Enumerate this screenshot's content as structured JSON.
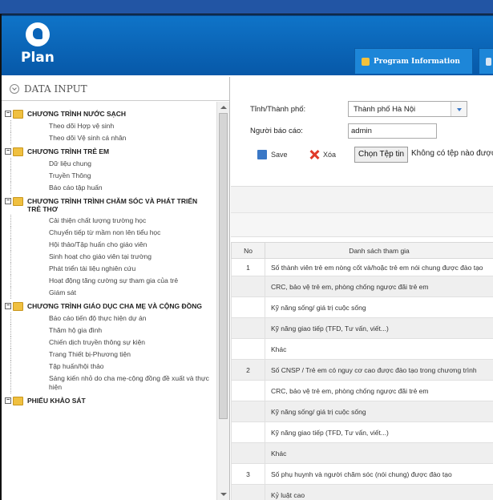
{
  "header": {
    "logo_text": "Plan",
    "tabs": [
      {
        "label": "Program Information",
        "icon": "document-icon"
      },
      {
        "label": "",
        "icon": "monitor-icon"
      }
    ]
  },
  "sidebar": {
    "title": "DATA INPUT",
    "groups": [
      {
        "label": "CHƯƠNG TRÌNH NƯỚC SẠCH",
        "items": [
          "Theo dõi Hợp vệ sinh",
          "Theo dõi Vệ sinh cá nhân"
        ]
      },
      {
        "label": "CHƯƠNG TRÌNH TRẺ EM",
        "items": [
          "Dữ liệu chung",
          "Truyền Thông",
          "Báo cáo tập huấn"
        ]
      },
      {
        "label": "CHƯƠNG TRÌNH TRÌNH CHĂM SÓC VÀ PHÁT TRIỂN TRẺ THƠ",
        "items": [
          "Cải thiện chất lượng trường học",
          "Chuyển tiếp từ mầm non lên tiểu học",
          "Hội thảo/Tập huấn cho giáo viên",
          "Sinh hoạt cho giáo viên tại trường",
          "Phát triển tài liệu nghiên cứu",
          "Hoạt động tăng cường sự tham gia của trẻ",
          "Giám sát"
        ]
      },
      {
        "label": "CHƯƠNG TRÌNH GIÁO DỤC CHA MẸ VÀ CỘNG ĐỒNG",
        "items": [
          "Báo cáo tiến độ thực hiện dự án",
          "Thăm hộ gia đình",
          "Chiến dịch truyền thông sự kiện",
          "Trang Thiết bị-Phương tiện",
          "Tập huấn/hội thảo",
          "Sáng kiến nhỏ do cha mẹ-cộng đồng đề xuất và thực hiện"
        ]
      },
      {
        "label": "PHIẾU KHẢO SÁT",
        "items": []
      }
    ]
  },
  "form": {
    "province_label": "Tỉnh/Thành phố:",
    "province_value": "Thành phố Hà Nội",
    "reporter_label": "Người báo cáo:",
    "reporter_value": "admin",
    "save_label": "Save",
    "delete_label": "Xóa",
    "choose_file_label": "Chọn Tệp tin",
    "no_file_text": "Không có tệp nào được chọn"
  },
  "table": {
    "headers": {
      "no": "No",
      "list": "Danh sách tham gia"
    },
    "rows": [
      {
        "no": "1",
        "text": "Số thành viên trẻ em nòng cốt và/hoặc trẻ em nói chung được đào tạo",
        "alt": false
      },
      {
        "no": "",
        "text": "CRC, bảo vệ trẻ em, phòng chống ngược đãi trẻ em",
        "alt": true
      },
      {
        "no": "",
        "text": "Kỹ năng sống/ giá trị cuộc sống",
        "alt": false
      },
      {
        "no": "",
        "text": "Kỹ năng giao tiếp (TFD, Tư vấn, viết...)",
        "alt": true
      },
      {
        "no": "",
        "text": "Khác",
        "alt": false
      },
      {
        "no": "2",
        "text": "Số CNSP / Trẻ em có nguy cơ cao được đào tạo trong chương trình",
        "alt": true
      },
      {
        "no": "",
        "text": "CRC, bảo vệ trẻ em, phòng chống ngược đãi trẻ em",
        "alt": false
      },
      {
        "no": "",
        "text": "Kỹ năng sống/ giá trị cuộc sống",
        "alt": true
      },
      {
        "no": "",
        "text": "Kỹ năng giao tiếp (TFD, Tư vấn, viết...)",
        "alt": false
      },
      {
        "no": "",
        "text": "Khác",
        "alt": true
      },
      {
        "no": "3",
        "text": "Số phụ huynh và người chăm sóc (nói chung) được đào tạo",
        "alt": false
      },
      {
        "no": "",
        "text": "Kỷ luật cao",
        "alt": true
      }
    ]
  },
  "colors": {
    "header_blue": "#0b64b8",
    "top_strip": "#2255a4",
    "folder": "#f0c040"
  }
}
